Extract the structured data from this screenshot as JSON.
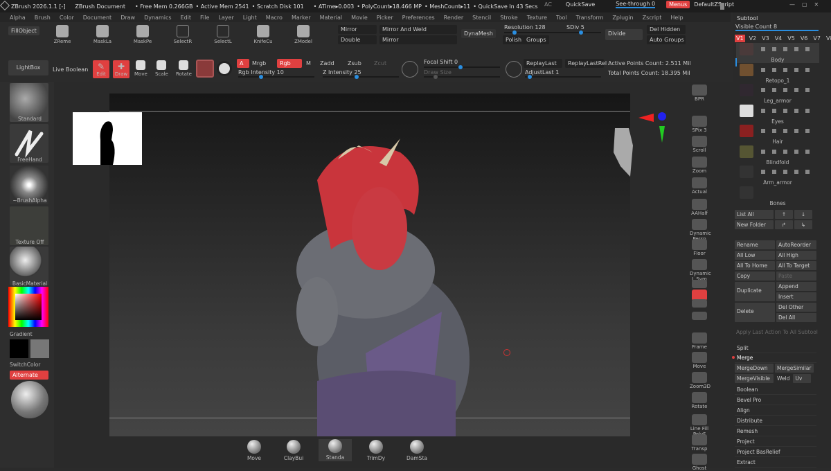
{
  "title": {
    "app": "ZBrush 2026.1.1 [-]",
    "doc": "ZBrush Document",
    "free_mem": "• Free Mem 0.266GB",
    "active_mem": "• Active Mem 2541",
    "scratch": "• Scratch Disk 101",
    "atime": "• ATime▸0.003",
    "polycount": "• PolyCount▸18.466 MP",
    "meshcount": "• MeshCount▸11",
    "quicksave_in": "• QuickSave In 43 Secs",
    "ac": "AC",
    "quicksave": "QuickSave",
    "see_through": "See-through  0",
    "menus": "Menus",
    "script": "DefaultZScript"
  },
  "menubar": [
    "Alpha",
    "Brush",
    "Color",
    "Document",
    "Draw",
    "Dynamics",
    "Edit",
    "File",
    "Layer",
    "Light",
    "Macro",
    "Marker",
    "Material",
    "Movie",
    "Picker",
    "Preferences",
    "Render",
    "Stencil",
    "Stroke",
    "Texture",
    "Tool",
    "Transform",
    "Zplugin",
    "Zscript",
    "Help"
  ],
  "toolbar": {
    "fillobject": "FillObject",
    "tools": [
      "ZReme",
      "MaskLa",
      "MaskPe",
      "SelectR",
      "SelectL",
      "KnifeCu",
      "ZModel"
    ],
    "mirror": "Mirror",
    "mirror_weld": "Mirror And Weld",
    "double": "Double",
    "mirror2": "Mirror",
    "dynamesh": "DynaMesh",
    "resolution": "Resolution 128",
    "sdiv": "SDiv 5",
    "polish": "Polish",
    "groups": "Groups",
    "divide": "Divide",
    "del_hidden": "Del Hidden",
    "auto_groups": "Auto Groups"
  },
  "toolbar2": {
    "lightbox": "LightBox",
    "live_boolean": "Live Boolean",
    "edit": "Edit",
    "draw": "Draw",
    "move": "Move",
    "scale": "Scale",
    "rotate": "Rotate",
    "a": "A",
    "mrgb": "Mrgb",
    "rgb": "Rgb",
    "m": "M",
    "zadd": "Zadd",
    "zsub": "Zsub",
    "zcut": "Zcut",
    "rgb_intensity": "Rgb Intensity 10",
    "z_intensity": "Z Intensity 25",
    "focal_shift": "Focal Shift 0",
    "draw_size": "Draw Size",
    "replaylast": "ReplayLast",
    "replaylastrel": "ReplayLastRel",
    "adjustlast": "AdjustLast 1",
    "active_points": "Active Points Count: 2.511 Mil",
    "total_points": "Total Points Count: 18.395 Mil"
  },
  "left": {
    "standard": "Standard",
    "freehand": "FreeHand",
    "brushalpha": "~BrushAlpha",
    "texture": "Texture Off",
    "material": "BasicMaterial",
    "gradient": "Gradient",
    "switchcolor": "SwitchColor",
    "alternate": "Alternate"
  },
  "right_tools": [
    "BPR",
    "SPix 3",
    "Scroll",
    "Zoom",
    "Actual",
    "AAHalf",
    "Dynamic Persp",
    "Floor",
    "Dynamic L.Sym",
    "",
    "XYZ",
    "",
    "",
    "Frame",
    "Move",
    "Zoom3D",
    "Rotate",
    "Line Fill PolyF",
    "Transp",
    "Ghost",
    "Dynamic"
  ],
  "subtool": {
    "header": "Subtool",
    "visible_count": "Visible Count 8",
    "versions": [
      "V1",
      "V2",
      "V3",
      "V4",
      "V5",
      "V6",
      "V7",
      "V8"
    ],
    "items": [
      "Body",
      "Retopo_1",
      "Leg_armor",
      "Eyes",
      "Hair",
      "Blindfold",
      "Arm_armor",
      "Bones"
    ],
    "list_all": "List All",
    "new_folder": "New Folder",
    "rename": "Rename",
    "autoreorder": "AutoReorder",
    "all_low": "All Low",
    "all_high": "All High",
    "all_to_home": "All To Home",
    "all_to_target": "All To Target",
    "copy": "Copy",
    "paste": "Paste",
    "duplicate": "Duplicate",
    "append": "Append",
    "insert": "Insert",
    "delete": "Delete",
    "del_other": "Del Other",
    "del_all": "Del All",
    "apply_last": "Apply Last Action To All Subtool",
    "split": "Split",
    "merge": "Merge",
    "mergedown": "MergeDown",
    "mergesimilar": "MergeSimilar",
    "mergevisible": "MergeVisible",
    "weld": "Weld",
    "uv": "Uv",
    "menu": [
      "Boolean",
      "Bevel Pro",
      "Align",
      "Distribute",
      "Remesh",
      "Project",
      "Project BasRelief",
      "Extract"
    ]
  },
  "bottom": [
    "Move",
    "ClayBui",
    "Standa",
    "TrimDy",
    "DamSta"
  ]
}
